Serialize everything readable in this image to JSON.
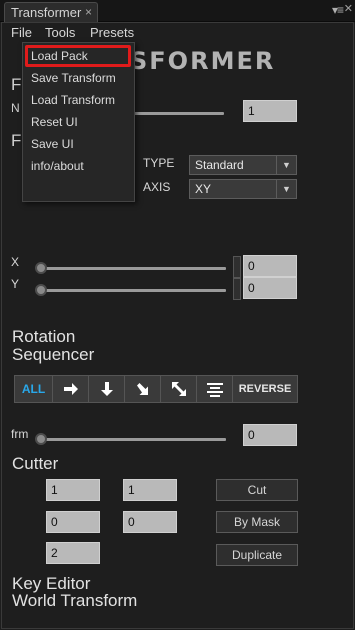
{
  "tab": {
    "title": "Transformer",
    "close": "×"
  },
  "panel_menu_icon": "≡",
  "menubar": {
    "file": "File",
    "tools": "Tools",
    "presets": "Presets"
  },
  "logo_visible": "SFORMER",
  "dropdown": {
    "items": [
      "Load Pack",
      "Save Transform",
      "Load Transform",
      "Reset UI",
      "Save UI",
      "info/about"
    ],
    "highlighted": "Load Pack",
    "highlight_color": "#e01b1b"
  },
  "partial": {
    "f1": "F",
    "n": "N",
    "f2": "F"
  },
  "fields": {
    "top": "1",
    "x": "0",
    "y": "0",
    "frm": "0"
  },
  "type": {
    "label": "TYPE",
    "value": "Standard"
  },
  "axis": {
    "label": "AXIS",
    "value": "XY"
  },
  "sliders": {
    "x_label": "X",
    "y_label": "Y",
    "frm_label": "frm"
  },
  "rotation_sequencer": {
    "line1": "Rotation",
    "line2": "Sequencer"
  },
  "sequencer_buttons": {
    "all": "ALL",
    "reverse": "REVERSE",
    "accent": "#29a8ea"
  },
  "cutter": {
    "title": "Cutter",
    "f1": "1",
    "f2": "1",
    "f3": "0",
    "f4": "0",
    "f5": "2",
    "cut": "Cut",
    "by_mask": "By Mask",
    "duplicate": "Duplicate"
  },
  "bottom": {
    "key_editor": "Key Editor",
    "world_transform": "World Transform"
  }
}
